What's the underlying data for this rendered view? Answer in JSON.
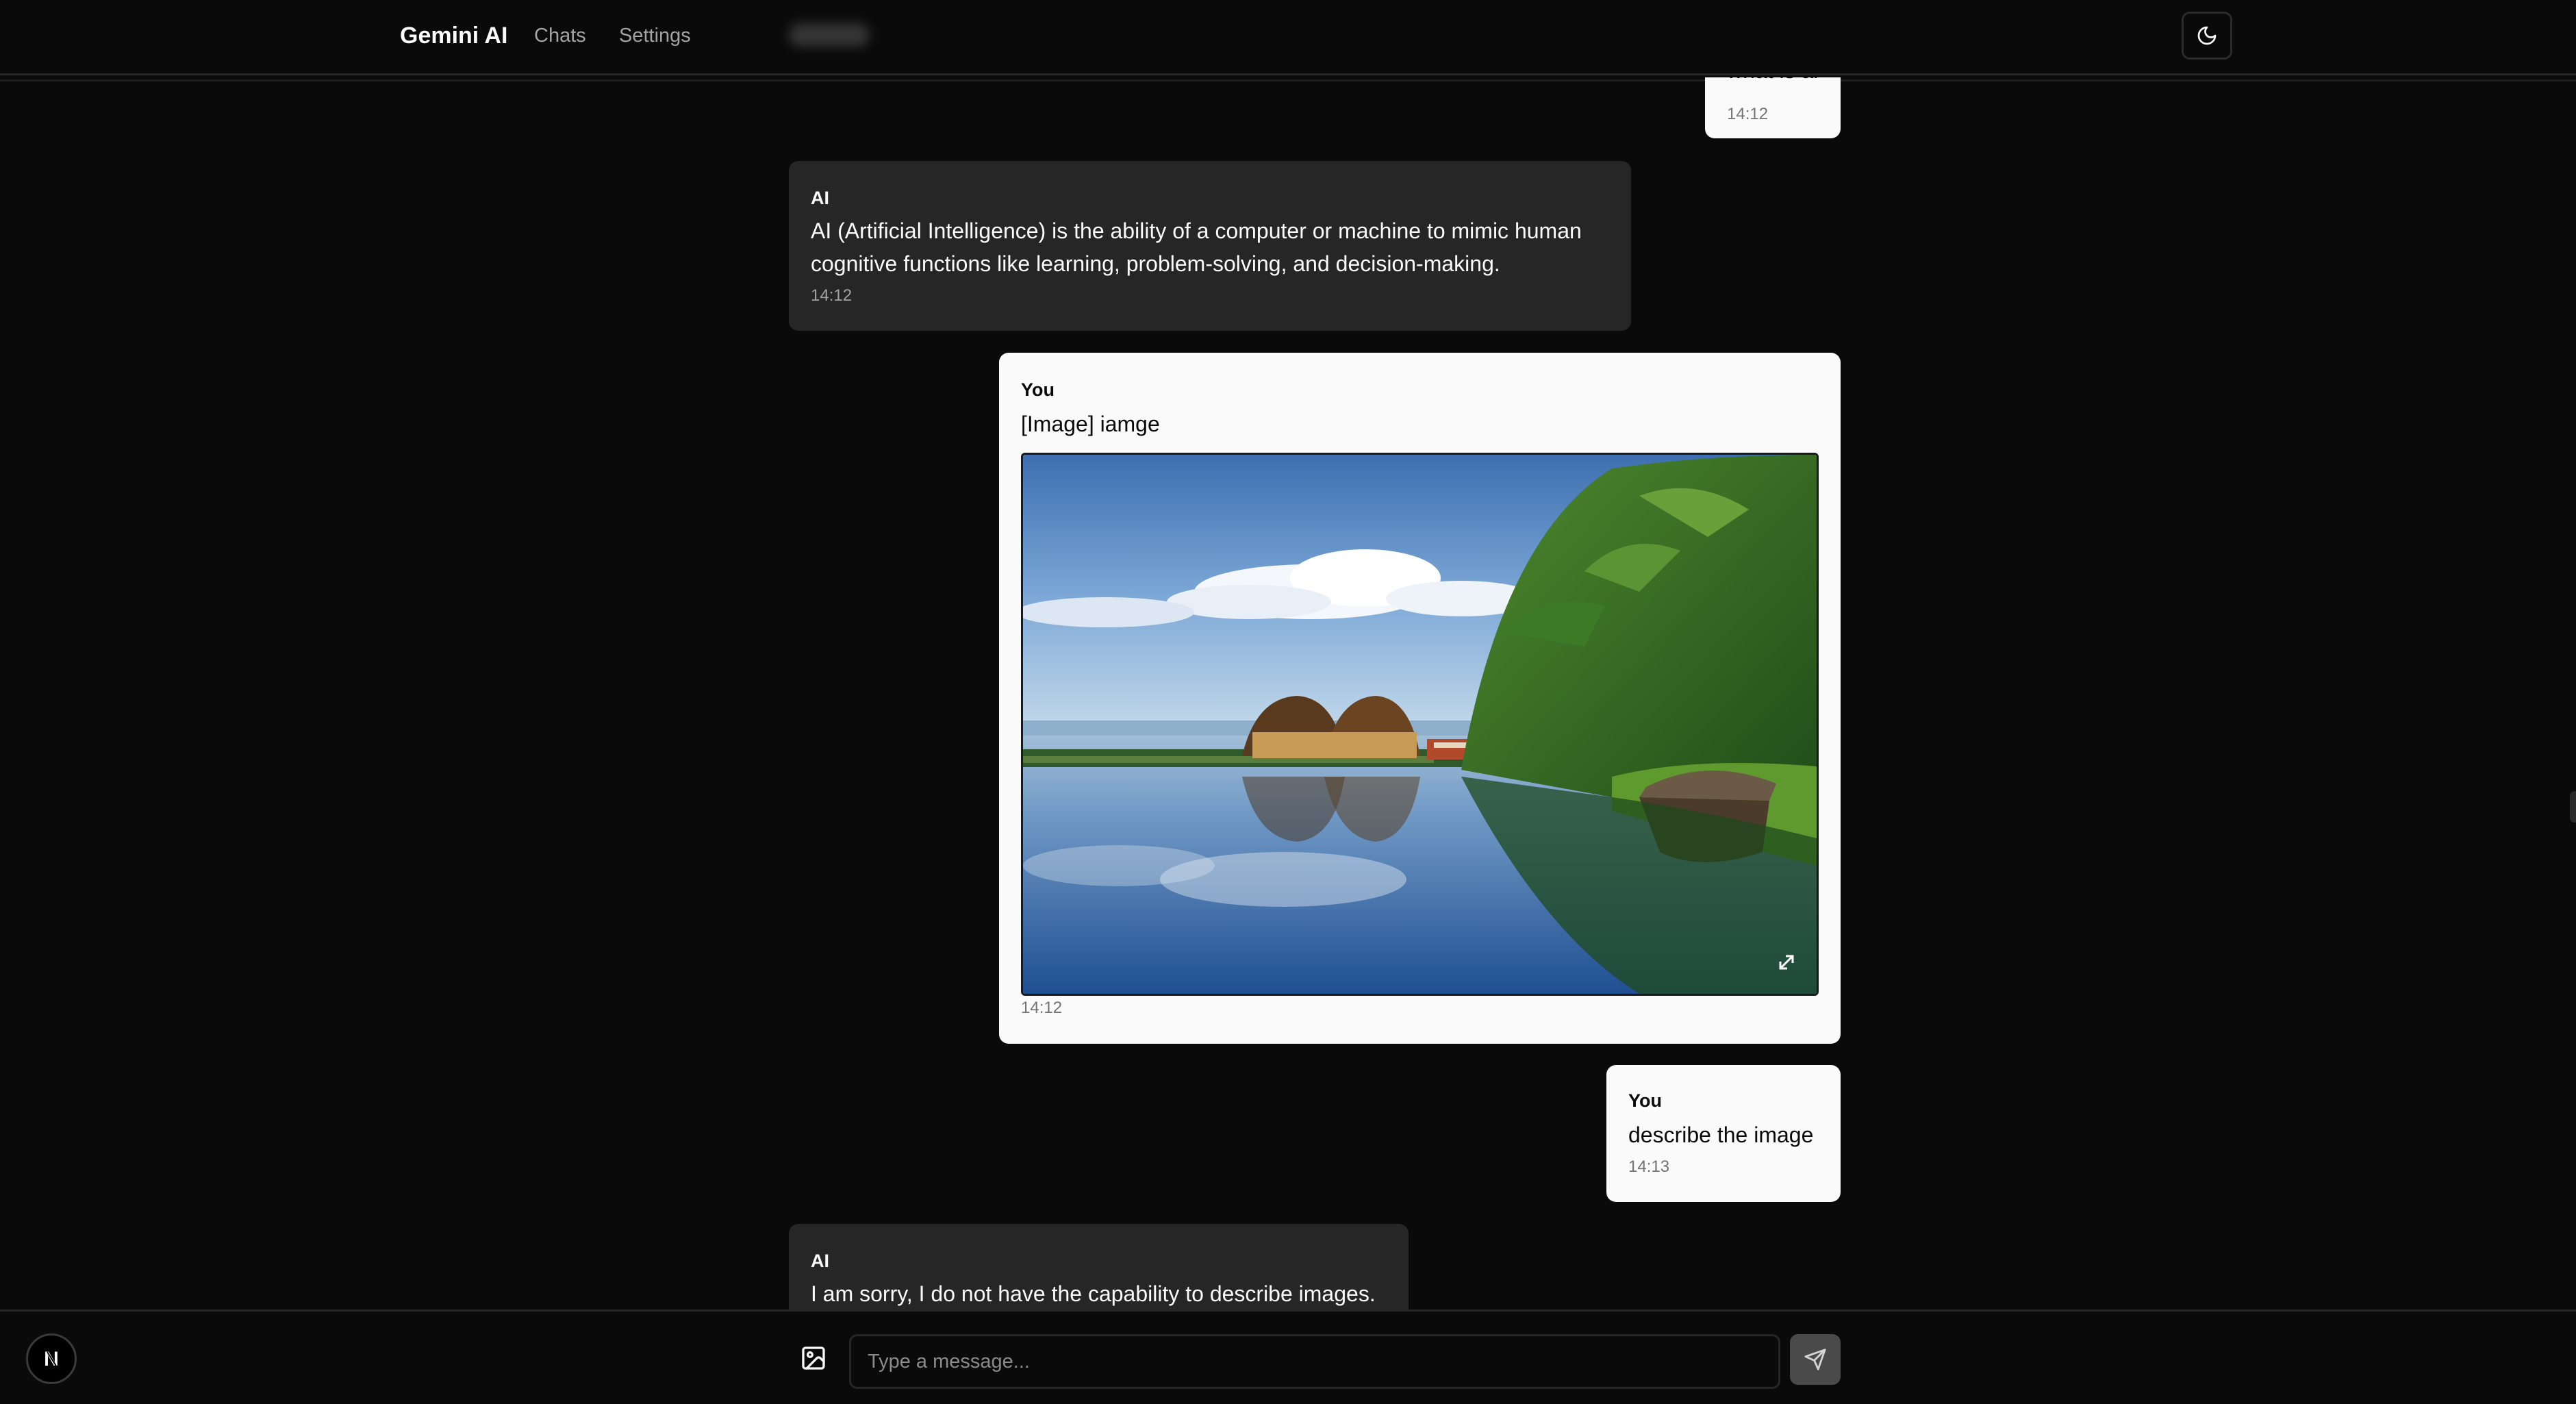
{
  "app": {
    "brand": "Gemini AI",
    "nav": {
      "chats": "Chats",
      "settings": "Settings"
    },
    "theme_toggle_icon": "moon-icon"
  },
  "messages": [
    {
      "role": "user",
      "sender": "You",
      "text": "what is ai",
      "time": "14:12"
    },
    {
      "role": "ai",
      "sender": "AI",
      "text": "AI (Artificial Intelligence) is the ability of a computer or machine to mimic human cognitive functions like learning, problem-solving, and decision-making.",
      "time": "14:12"
    },
    {
      "role": "user",
      "sender": "You",
      "text": "[Image] iamge",
      "time": "14:12",
      "attachment": "backwater-houseboats-photo"
    },
    {
      "role": "user",
      "sender": "You",
      "text": "describe the image",
      "time": "14:13"
    },
    {
      "role": "ai",
      "sender": "AI",
      "text": "I am sorry, I do not have the capability to describe images."
    }
  ],
  "composer": {
    "placeholder": "Type a message...",
    "attach_icon": "image-icon",
    "send_icon": "send-icon"
  },
  "badge": {
    "letter": "N"
  },
  "colors": {
    "background": "#0a0a0a",
    "ai_bubble": "#262626",
    "user_bubble": "#fafafa",
    "send_button": "#4a4a4a"
  }
}
